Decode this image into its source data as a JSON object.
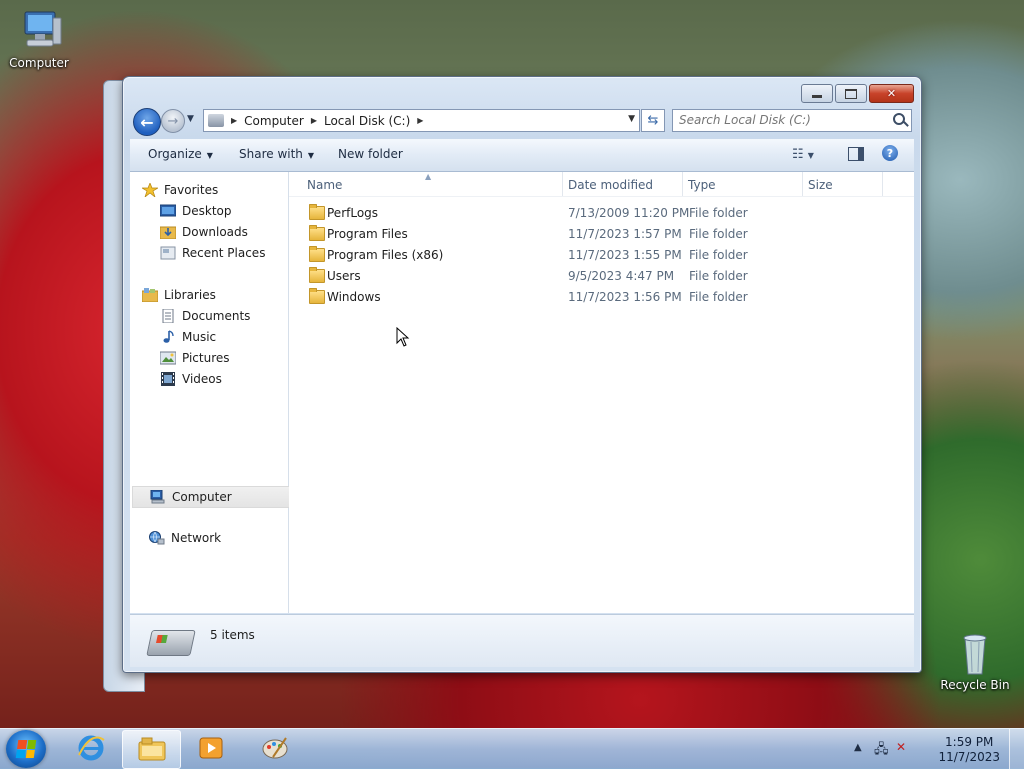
{
  "desktop": {
    "icons": [
      {
        "label": "Computer",
        "icon": "computer-icon"
      },
      {
        "label": "Recycle Bin",
        "icon": "recycle-bin-icon"
      }
    ]
  },
  "window": {
    "caption_buttons": [
      "minimize",
      "maximize",
      "close"
    ],
    "address": {
      "crumbs": [
        "Computer",
        "Local Disk (C:)"
      ]
    },
    "search": {
      "placeholder": "Search Local Disk (C:)"
    },
    "toolbar": {
      "organize": "Organize",
      "share_with": "Share with",
      "new_folder": "New folder"
    },
    "nav_pane": {
      "favorites": {
        "label": "Favorites",
        "items": [
          "Desktop",
          "Downloads",
          "Recent Places"
        ]
      },
      "libraries": {
        "label": "Libraries",
        "items": [
          "Documents",
          "Music",
          "Pictures",
          "Videos"
        ]
      },
      "computer": "Computer",
      "network": "Network"
    },
    "columns": {
      "name": "Name",
      "date": "Date modified",
      "type": "Type",
      "size": "Size"
    },
    "files": [
      {
        "name": "PerfLogs",
        "date": "7/13/2009 11:20 PM",
        "type": "File folder"
      },
      {
        "name": "Program Files",
        "date": "11/7/2023 1:57 PM",
        "type": "File folder"
      },
      {
        "name": "Program Files (x86)",
        "date": "11/7/2023 1:55 PM",
        "type": "File folder"
      },
      {
        "name": "Users",
        "date": "9/5/2023 4:47 PM",
        "type": "File folder"
      },
      {
        "name": "Windows",
        "date": "11/7/2023 1:56 PM",
        "type": "File folder"
      }
    ],
    "status": {
      "item_count": "5 items"
    }
  },
  "taskbar": {
    "pinned": [
      "internet-explorer-icon",
      "windows-explorer-icon",
      "media-player-icon",
      "paint-icon"
    ],
    "active": "windows-explorer-icon",
    "clock": {
      "time": "1:59 PM",
      "date": "11/7/2023"
    }
  },
  "colors": {
    "accent": "#1f5fbf",
    "window_frame": "#c9d9ec",
    "taskbar": "#a0bee1"
  }
}
